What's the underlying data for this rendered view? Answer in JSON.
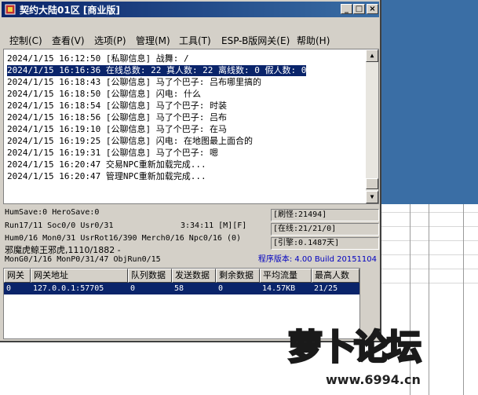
{
  "window": {
    "title": "契约大陆01区 [商业版]",
    "controls": {
      "minimize": "_",
      "maximize": "□",
      "close": "×"
    }
  },
  "menu": [
    "控制(C)",
    "查看(V)",
    "选项(P)",
    "管理(M)",
    "工具(T)",
    "ESP-B版网关(E)",
    "帮助(H)"
  ],
  "log": [
    "2024/1/15 16:12:50 [私聊信息] 战舞: /",
    "2024/1/15 16:16:36 在线总数: 22 真人数: 22 离线数: 0 假人数: 0",
    "2024/1/15 16:18:43 [公聊信息] 马了个巴子: 吕布哪里搞的",
    "2024/1/15 16:18:50 [公聊信息] 闪电: 什么",
    "2024/1/15 16:18:54 [公聊信息] 马了个巴子: 时装",
    "2024/1/15 16:18:56 [公聊信息] 马了个巴子: 吕布",
    "2024/1/15 16:19:10 [公聊信息] 马了个巴子: 在马",
    "2024/1/15 16:19:25 [公聊信息] 闪电: 在地图最上面合的",
    "2024/1/15 16:19:31 [公聊信息] 马了个巴子: 嗯",
    "2024/1/15 16:20:47 交易NPC重新加载完成...",
    "2024/1/15 16:20:47 管理NPC重新加载完成..."
  ],
  "status": {
    "line1": "HumSave:0 HeroSave:0",
    "line2": "Run17/11 Soc0/0 Usr0/31",
    "time": "3:34:11 [M][F]",
    "line3": "Hum0/16 Mon0/31 UsrRot16/390 Merch0/16 Npc0/16 (0)",
    "line4": "邪魔虎鲸王邪虎,1110/1882 -",
    "line5": "MonG0/1/16 MonP0/31/47 ObjRun0/15",
    "refresh": "[刷怪:21494]",
    "online": "[在线:21/21/0]",
    "engine": "[引擎:0.1487天]",
    "version": "程序版本: 4.00 Build 20151104"
  },
  "table": {
    "headers": [
      "网关",
      "网关地址",
      "队列数据",
      "发送数据",
      "剩余数据",
      "平均流量",
      "最高人数"
    ],
    "rows": [
      [
        "0",
        "127.0.0.1:57705",
        "0",
        "58",
        "0",
        "14.57KB",
        "21/25"
      ]
    ]
  },
  "watermark": {
    "text": "萝卜论坛",
    "url": "www.6994.cn"
  }
}
